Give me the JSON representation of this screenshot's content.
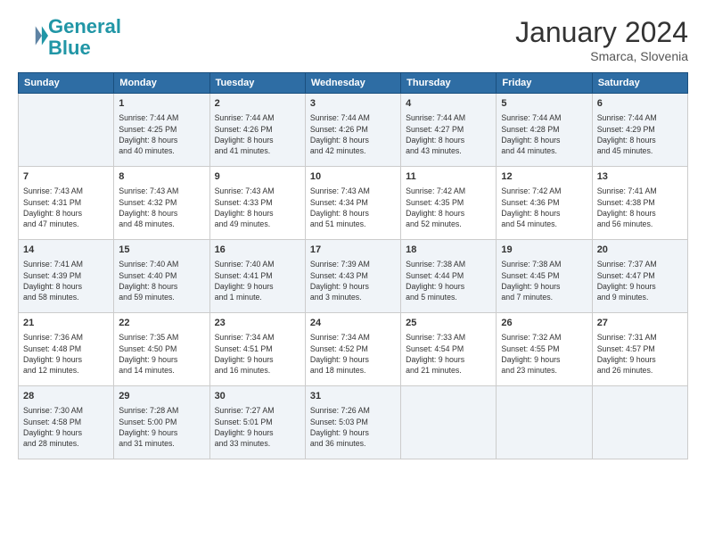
{
  "header": {
    "logo_line1": "General",
    "logo_line2": "Blue",
    "month": "January 2024",
    "location": "Smarca, Slovenia"
  },
  "columns": [
    "Sunday",
    "Monday",
    "Tuesday",
    "Wednesday",
    "Thursday",
    "Friday",
    "Saturday"
  ],
  "weeks": [
    [
      {
        "day": "",
        "info": ""
      },
      {
        "day": "1",
        "info": "Sunrise: 7:44 AM\nSunset: 4:25 PM\nDaylight: 8 hours\nand 40 minutes."
      },
      {
        "day": "2",
        "info": "Sunrise: 7:44 AM\nSunset: 4:26 PM\nDaylight: 8 hours\nand 41 minutes."
      },
      {
        "day": "3",
        "info": "Sunrise: 7:44 AM\nSunset: 4:26 PM\nDaylight: 8 hours\nand 42 minutes."
      },
      {
        "day": "4",
        "info": "Sunrise: 7:44 AM\nSunset: 4:27 PM\nDaylight: 8 hours\nand 43 minutes."
      },
      {
        "day": "5",
        "info": "Sunrise: 7:44 AM\nSunset: 4:28 PM\nDaylight: 8 hours\nand 44 minutes."
      },
      {
        "day": "6",
        "info": "Sunrise: 7:44 AM\nSunset: 4:29 PM\nDaylight: 8 hours\nand 45 minutes."
      }
    ],
    [
      {
        "day": "7",
        "info": "Sunrise: 7:43 AM\nSunset: 4:31 PM\nDaylight: 8 hours\nand 47 minutes."
      },
      {
        "day": "8",
        "info": "Sunrise: 7:43 AM\nSunset: 4:32 PM\nDaylight: 8 hours\nand 48 minutes."
      },
      {
        "day": "9",
        "info": "Sunrise: 7:43 AM\nSunset: 4:33 PM\nDaylight: 8 hours\nand 49 minutes."
      },
      {
        "day": "10",
        "info": "Sunrise: 7:43 AM\nSunset: 4:34 PM\nDaylight: 8 hours\nand 51 minutes."
      },
      {
        "day": "11",
        "info": "Sunrise: 7:42 AM\nSunset: 4:35 PM\nDaylight: 8 hours\nand 52 minutes."
      },
      {
        "day": "12",
        "info": "Sunrise: 7:42 AM\nSunset: 4:36 PM\nDaylight: 8 hours\nand 54 minutes."
      },
      {
        "day": "13",
        "info": "Sunrise: 7:41 AM\nSunset: 4:38 PM\nDaylight: 8 hours\nand 56 minutes."
      }
    ],
    [
      {
        "day": "14",
        "info": "Sunrise: 7:41 AM\nSunset: 4:39 PM\nDaylight: 8 hours\nand 58 minutes."
      },
      {
        "day": "15",
        "info": "Sunrise: 7:40 AM\nSunset: 4:40 PM\nDaylight: 8 hours\nand 59 minutes."
      },
      {
        "day": "16",
        "info": "Sunrise: 7:40 AM\nSunset: 4:41 PM\nDaylight: 9 hours\nand 1 minute."
      },
      {
        "day": "17",
        "info": "Sunrise: 7:39 AM\nSunset: 4:43 PM\nDaylight: 9 hours\nand 3 minutes."
      },
      {
        "day": "18",
        "info": "Sunrise: 7:38 AM\nSunset: 4:44 PM\nDaylight: 9 hours\nand 5 minutes."
      },
      {
        "day": "19",
        "info": "Sunrise: 7:38 AM\nSunset: 4:45 PM\nDaylight: 9 hours\nand 7 minutes."
      },
      {
        "day": "20",
        "info": "Sunrise: 7:37 AM\nSunset: 4:47 PM\nDaylight: 9 hours\nand 9 minutes."
      }
    ],
    [
      {
        "day": "21",
        "info": "Sunrise: 7:36 AM\nSunset: 4:48 PM\nDaylight: 9 hours\nand 12 minutes."
      },
      {
        "day": "22",
        "info": "Sunrise: 7:35 AM\nSunset: 4:50 PM\nDaylight: 9 hours\nand 14 minutes."
      },
      {
        "day": "23",
        "info": "Sunrise: 7:34 AM\nSunset: 4:51 PM\nDaylight: 9 hours\nand 16 minutes."
      },
      {
        "day": "24",
        "info": "Sunrise: 7:34 AM\nSunset: 4:52 PM\nDaylight: 9 hours\nand 18 minutes."
      },
      {
        "day": "25",
        "info": "Sunrise: 7:33 AM\nSunset: 4:54 PM\nDaylight: 9 hours\nand 21 minutes."
      },
      {
        "day": "26",
        "info": "Sunrise: 7:32 AM\nSunset: 4:55 PM\nDaylight: 9 hours\nand 23 minutes."
      },
      {
        "day": "27",
        "info": "Sunrise: 7:31 AM\nSunset: 4:57 PM\nDaylight: 9 hours\nand 26 minutes."
      }
    ],
    [
      {
        "day": "28",
        "info": "Sunrise: 7:30 AM\nSunset: 4:58 PM\nDaylight: 9 hours\nand 28 minutes."
      },
      {
        "day": "29",
        "info": "Sunrise: 7:28 AM\nSunset: 5:00 PM\nDaylight: 9 hours\nand 31 minutes."
      },
      {
        "day": "30",
        "info": "Sunrise: 7:27 AM\nSunset: 5:01 PM\nDaylight: 9 hours\nand 33 minutes."
      },
      {
        "day": "31",
        "info": "Sunrise: 7:26 AM\nSunset: 5:03 PM\nDaylight: 9 hours\nand 36 minutes."
      },
      {
        "day": "",
        "info": ""
      },
      {
        "day": "",
        "info": ""
      },
      {
        "day": "",
        "info": ""
      }
    ]
  ]
}
